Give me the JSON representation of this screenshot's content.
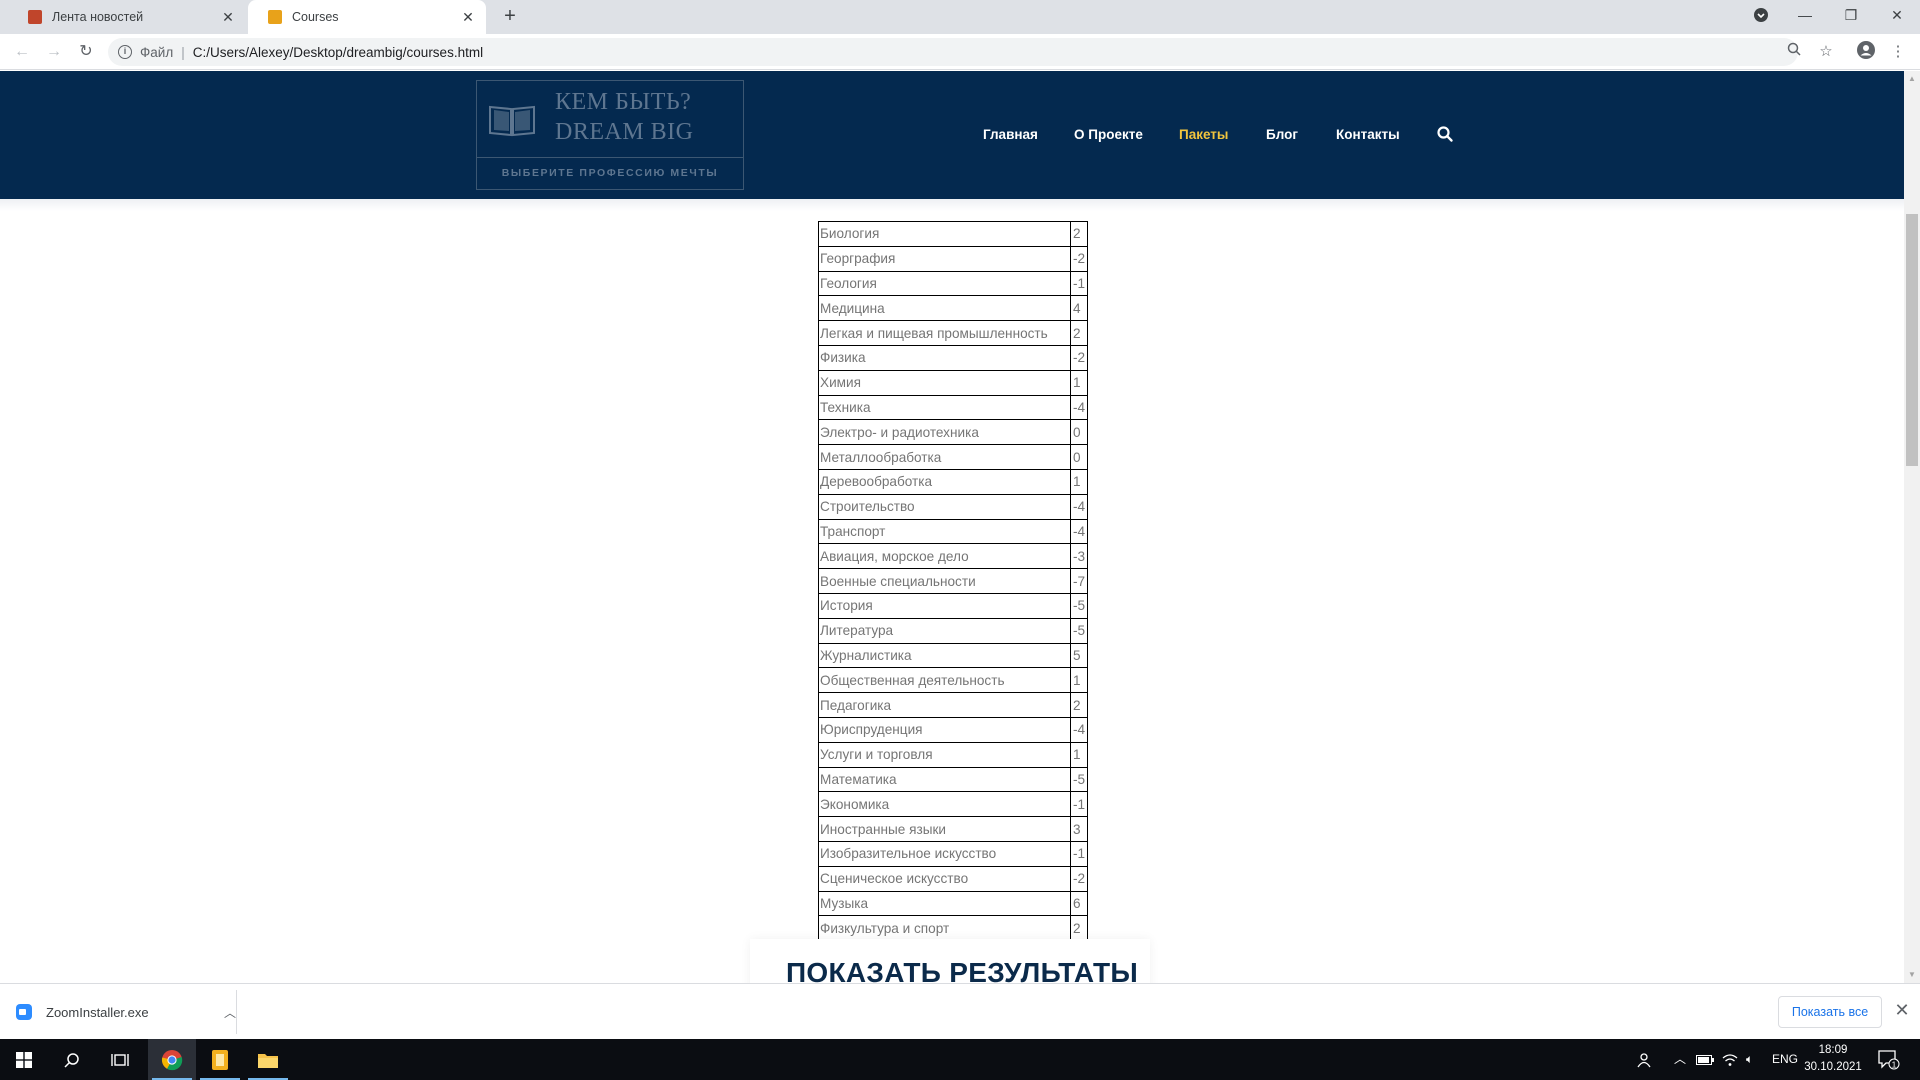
{
  "browser": {
    "tabs": [
      {
        "title": "Лента новостей",
        "active": false
      },
      {
        "title": "Courses",
        "active": true
      }
    ],
    "address": {
      "scheme_label": "Файл",
      "url": "C:/Users/Alexey/Desktop/dreambig/courses.html"
    }
  },
  "site": {
    "logo": {
      "line1": "КЕМ БЫТЬ?",
      "line2": "DREAM BIG",
      "tagline": "ВЫБЕРИТЕ ПРОФЕССИЮ МЕЧТЫ"
    },
    "nav": [
      {
        "label": "Главная",
        "active": false
      },
      {
        "label": "О Проекте",
        "active": false
      },
      {
        "label": "Пакеты",
        "active": true
      },
      {
        "label": "Блог",
        "active": false
      },
      {
        "label": "Контакты",
        "active": false
      }
    ],
    "accent_color": "#f2c53d",
    "header_color": "#04294f"
  },
  "courses": [
    {
      "name": "Биология",
      "value": "2"
    },
    {
      "name": "Георграфия",
      "value": "-2"
    },
    {
      "name": "Геология",
      "value": "-1"
    },
    {
      "name": "Медицина",
      "value": "4"
    },
    {
      "name": "Легкая и пищевая промышленность",
      "value": "2"
    },
    {
      "name": "Физика",
      "value": "-2"
    },
    {
      "name": "Химия",
      "value": "1"
    },
    {
      "name": "Техника",
      "value": "-4"
    },
    {
      "name": "Электро- и радиотехника",
      "value": "0"
    },
    {
      "name": "Металлообработка",
      "value": "0"
    },
    {
      "name": "Деревообработка",
      "value": "1"
    },
    {
      "name": "Строительство",
      "value": "-4"
    },
    {
      "name": "Транспорт",
      "value": "-4"
    },
    {
      "name": "Авиация, морское дело",
      "value": "-3"
    },
    {
      "name": "Военные специальности",
      "value": "-7"
    },
    {
      "name": "История",
      "value": "-5"
    },
    {
      "name": "Литература",
      "value": "-5"
    },
    {
      "name": "Журналистика",
      "value": "5"
    },
    {
      "name": "Общественная деятельность",
      "value": "1"
    },
    {
      "name": "Педагогика",
      "value": "2"
    },
    {
      "name": "Юриспруденция",
      "value": "-4"
    },
    {
      "name": "Услуги и торговля",
      "value": "1"
    },
    {
      "name": "Математика",
      "value": "-5"
    },
    {
      "name": "Экономика",
      "value": "-1"
    },
    {
      "name": "Иностранные языки",
      "value": "3"
    },
    {
      "name": "Изобразительное искусство",
      "value": "-1"
    },
    {
      "name": "Сценическое искусство",
      "value": "-2"
    },
    {
      "name": "Музыка",
      "value": "6"
    },
    {
      "name": "Физкультура и спорт",
      "value": "2"
    }
  ],
  "results_button": "ПОКАЗАТЬ РЕЗУЛЬТАТЫ",
  "downloads": {
    "file": "ZoomInstaller.exe",
    "show_all": "Показать все"
  },
  "taskbar": {
    "lang": "ENG",
    "time": "18:09",
    "date": "30.10.2021",
    "notifications": "1"
  }
}
